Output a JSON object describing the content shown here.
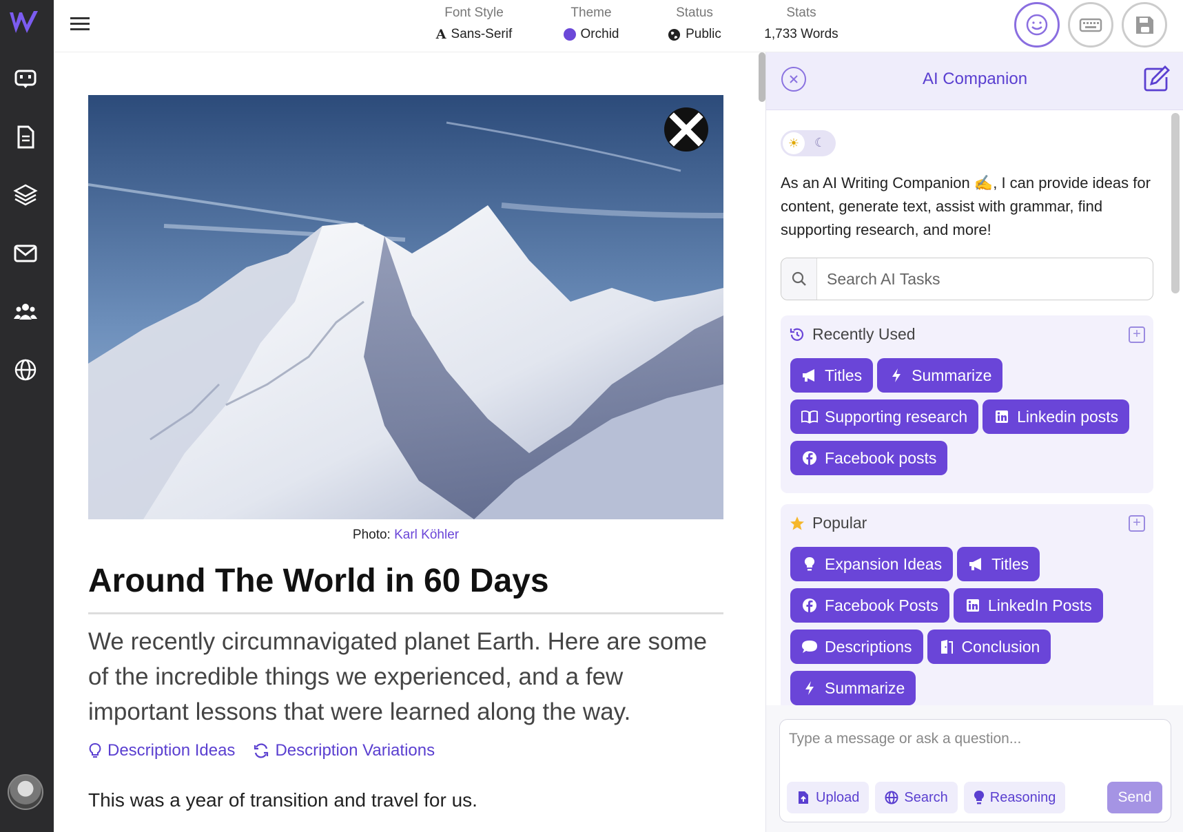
{
  "topbar": {
    "font_style": {
      "label": "Font Style",
      "value": "Sans-Serif",
      "icon": "A"
    },
    "theme": {
      "label": "Theme",
      "value": "Orchid",
      "color": "#6b48d8"
    },
    "status": {
      "label": "Status",
      "value": "Public"
    },
    "stats": {
      "label": "Stats",
      "value": "1,733 Words"
    }
  },
  "sidebar": {
    "items": [
      {
        "name": "ai-companion-icon"
      },
      {
        "name": "document-icon"
      },
      {
        "name": "layers-icon"
      },
      {
        "name": "mail-icon"
      },
      {
        "name": "users-icon"
      },
      {
        "name": "globe-icon"
      }
    ]
  },
  "article": {
    "photo_credit_prefix": "Photo:",
    "photo_credit_name": "Karl Köhler",
    "title": "Around The World in 60 Days",
    "lede": "We recently circumnavigated planet Earth. Here are some of the incredible things we experienced, and a few important lessons that were learned along the way.",
    "link_ideas": "Description Ideas",
    "link_variations": "Description Variations",
    "body_first": "This was a year of transition and travel for us."
  },
  "panel": {
    "title": "AI Companion",
    "intro": "As an AI Writing Companion ✍️, I can provide ideas for content, generate text, assist with grammar, find supporting research, and more!",
    "search_placeholder": "Search AI Tasks",
    "recent": {
      "heading": "Recently Used",
      "chips": [
        {
          "label": "Titles",
          "icon": "megaphone-icon"
        },
        {
          "label": "Summarize",
          "icon": "bolt-icon"
        },
        {
          "label": "Supporting research",
          "icon": "book-icon"
        },
        {
          "label": "Linkedin posts",
          "icon": "linkedin-icon"
        },
        {
          "label": "Facebook posts",
          "icon": "facebook-icon"
        }
      ]
    },
    "popular": {
      "heading": "Popular",
      "chips": [
        {
          "label": "Expansion Ideas",
          "icon": "lightbulb-icon"
        },
        {
          "label": "Titles",
          "icon": "megaphone-icon"
        },
        {
          "label": "Facebook Posts",
          "icon": "facebook-icon"
        },
        {
          "label": "LinkedIn Posts",
          "icon": "linkedin-icon"
        },
        {
          "label": "Descriptions",
          "icon": "speech-bubble-icon"
        },
        {
          "label": "Conclusion",
          "icon": "door-icon"
        },
        {
          "label": "Summarize",
          "icon": "bolt-icon"
        }
      ]
    },
    "composer": {
      "placeholder": "Type a message or ask a question...",
      "upload": "Upload",
      "search": "Search",
      "reasoning": "Reasoning",
      "send": "Send"
    }
  }
}
